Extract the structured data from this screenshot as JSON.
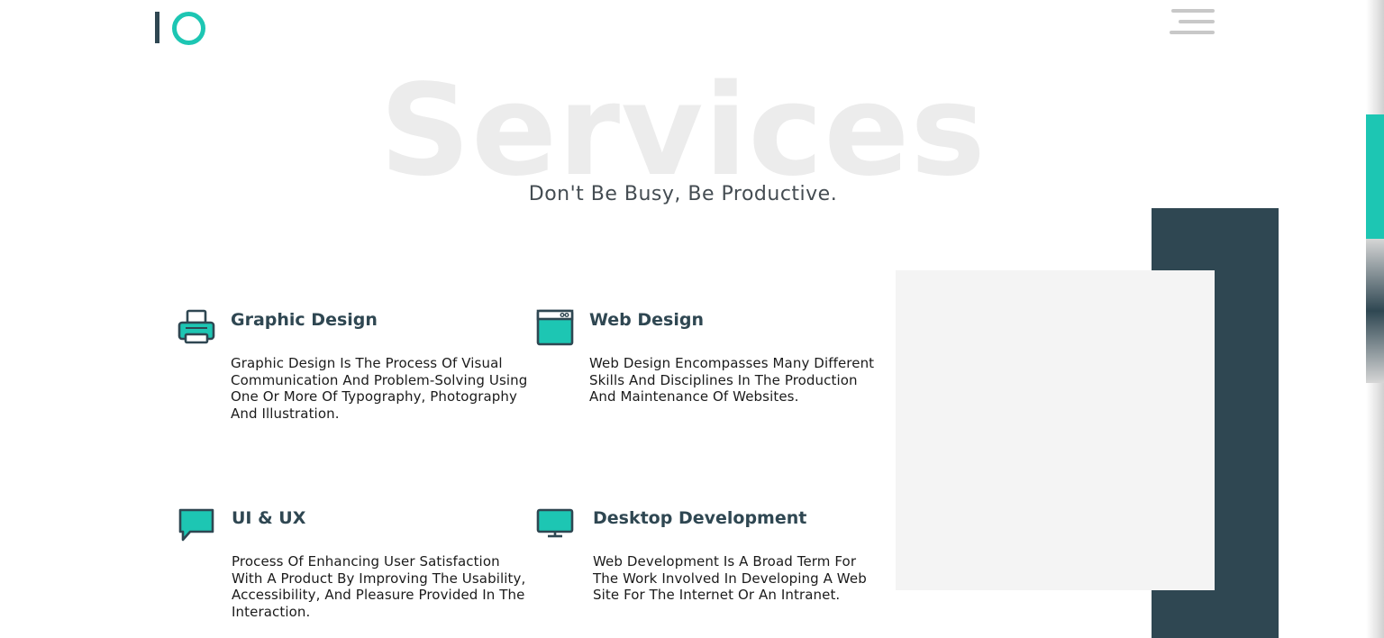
{
  "header": {
    "logo_name": "io-logo",
    "menu_icon": "hamburger-icon"
  },
  "section": {
    "big_title": "Services",
    "subtitle": "Don't Be Busy, Be Productive."
  },
  "services": [
    {
      "icon": "printer-icon",
      "title": "Graphic Design",
      "description": "Graphic Design Is The Process Of Visual Communication And Problem-Solving Using One Or More Of Typography, Photography And Illustration."
    },
    {
      "icon": "browser-window-icon",
      "title": "Web Design",
      "description": "Web Design Encompasses Many Different Skills And Disciplines In The Production And Maintenance Of Websites."
    },
    {
      "icon": "chat-bubble-icon",
      "title": "UI & UX",
      "description": "Process Of Enhancing User Satisfaction With A Product By Improving The Usability, Accessibility, And Pleasure Provided In The Interaction."
    },
    {
      "icon": "monitor-icon",
      "title": "Desktop Development",
      "description": "Web Development Is A Broad Term For The Work Involved In Developing A Web Site For The Internet Or An Intranet."
    }
  ],
  "colors": {
    "accent": "#1dc6b3",
    "dark": "#2f4752",
    "light_block": "#f4f4f4",
    "watermark": "#ececec"
  }
}
